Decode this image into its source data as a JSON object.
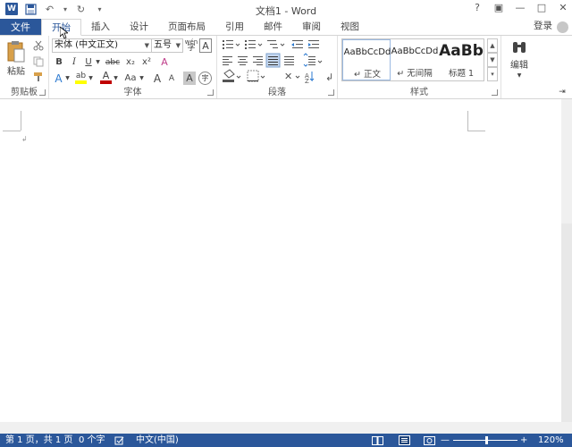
{
  "window": {
    "title": "文档1 - Word"
  },
  "quick_access": {
    "word_icon": "W",
    "undo_icon": "↶",
    "undo_arrow": "▾",
    "redo_icon": "↻",
    "customize_icon": "▾"
  },
  "window_controls": {
    "help": "?",
    "ribbon_options": "▣",
    "minimize": "—",
    "restore": "□",
    "close": "✕"
  },
  "tabs": [
    "文件",
    "开始",
    "插入",
    "设计",
    "页面布局",
    "引用",
    "邮件",
    "审阅",
    "视图"
  ],
  "active_tab": "开始",
  "account": {
    "login_label": "登录"
  },
  "clipboard": {
    "label": "剪贴板",
    "paste": "粘贴"
  },
  "font": {
    "label": "字体",
    "font_name": "宋体 (中文正文)",
    "font_size": "五号",
    "grow": "A",
    "shrink": "A",
    "bold": "B",
    "italic": "I",
    "underline": "U",
    "strike": "abc",
    "subscript": "x₂",
    "superscript": "x²",
    "change_case": "Aa",
    "highlight": "ab",
    "font_color": "A",
    "enclose": "字",
    "phonetic": "wén",
    "char_border": "A",
    "char_shading": "A",
    "clear_format": "A"
  },
  "paragraph": {
    "label": "段落"
  },
  "styles": {
    "label": "样式",
    "items": [
      {
        "sample": "AaBbCcDd",
        "name": "↵ 正文"
      },
      {
        "sample": "AaBbCcDd",
        "name": "↵ 无间隔"
      },
      {
        "sample": "AaBb",
        "name": "标题 1"
      }
    ]
  },
  "editing": {
    "label": "编辑"
  },
  "status": {
    "page": "第 1 页，共 1 页",
    "words": "0 个字",
    "language": "中文(中国)",
    "zoom": "120%",
    "zoom_minus": "—",
    "zoom_plus": "+"
  },
  "colors": {
    "accent": "#2b579a",
    "highlight": "#ffff00",
    "font_color": "#c00000"
  }
}
